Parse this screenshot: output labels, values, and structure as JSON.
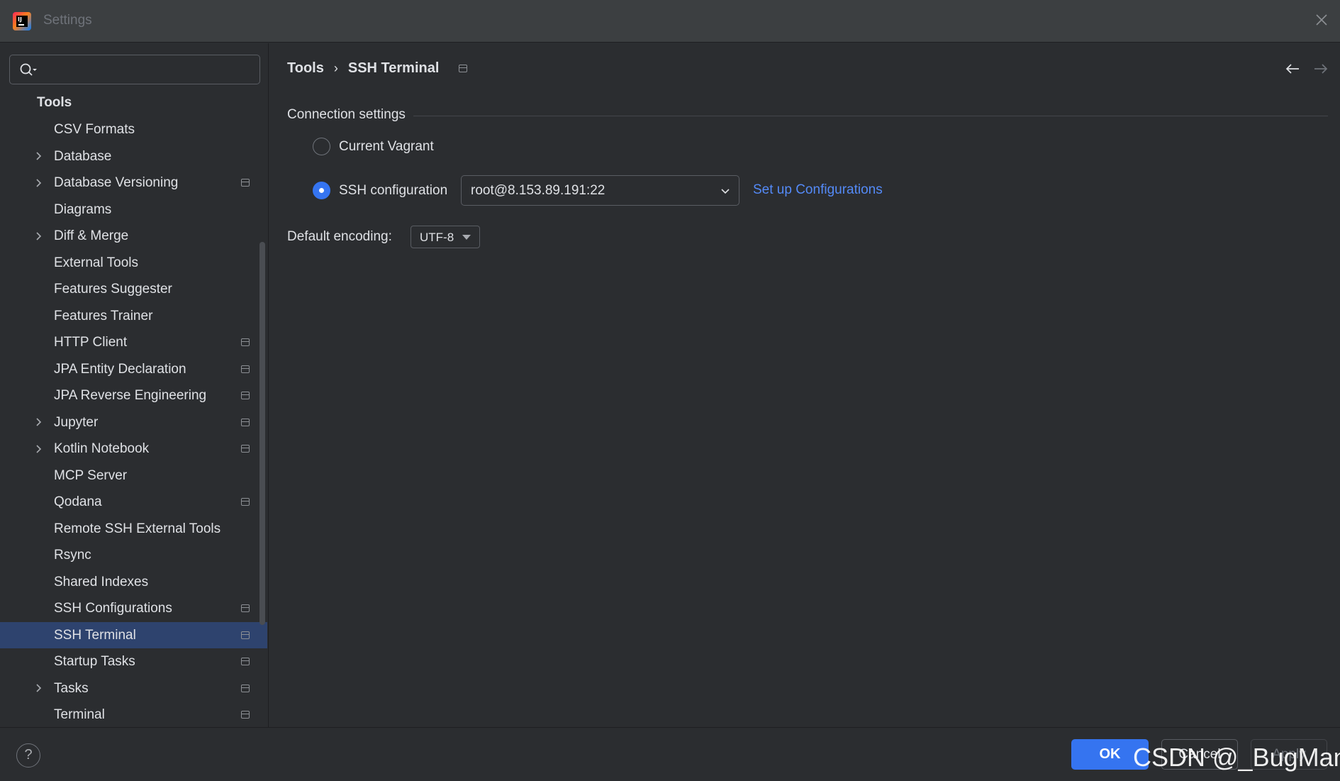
{
  "window": {
    "title": "Settings"
  },
  "search": {
    "placeholder": "",
    "value": ""
  },
  "sidebar": {
    "header": "Tools",
    "items": [
      {
        "label": "CSV Formats",
        "expandable": false,
        "project_icon": false,
        "selected": false
      },
      {
        "label": "Database",
        "expandable": true,
        "project_icon": false,
        "selected": false
      },
      {
        "label": "Database Versioning",
        "expandable": true,
        "project_icon": true,
        "selected": false
      },
      {
        "label": "Diagrams",
        "expandable": false,
        "project_icon": false,
        "selected": false
      },
      {
        "label": "Diff & Merge",
        "expandable": true,
        "project_icon": false,
        "selected": false
      },
      {
        "label": "External Tools",
        "expandable": false,
        "project_icon": false,
        "selected": false
      },
      {
        "label": "Features Suggester",
        "expandable": false,
        "project_icon": false,
        "selected": false
      },
      {
        "label": "Features Trainer",
        "expandable": false,
        "project_icon": false,
        "selected": false
      },
      {
        "label": "HTTP Client",
        "expandable": false,
        "project_icon": true,
        "selected": false
      },
      {
        "label": "JPA Entity Declaration",
        "expandable": false,
        "project_icon": true,
        "selected": false
      },
      {
        "label": "JPA Reverse Engineering",
        "expandable": false,
        "project_icon": true,
        "selected": false
      },
      {
        "label": "Jupyter",
        "expandable": true,
        "project_icon": true,
        "selected": false
      },
      {
        "label": "Kotlin Notebook",
        "expandable": true,
        "project_icon": true,
        "selected": false
      },
      {
        "label": "MCP Server",
        "expandable": false,
        "project_icon": false,
        "selected": false
      },
      {
        "label": "Qodana",
        "expandable": false,
        "project_icon": true,
        "selected": false
      },
      {
        "label": "Remote SSH External Tools",
        "expandable": false,
        "project_icon": false,
        "selected": false
      },
      {
        "label": "Rsync",
        "expandable": false,
        "project_icon": false,
        "selected": false
      },
      {
        "label": "Shared Indexes",
        "expandable": false,
        "project_icon": false,
        "selected": false
      },
      {
        "label": "SSH Configurations",
        "expandable": false,
        "project_icon": true,
        "selected": false
      },
      {
        "label": "SSH Terminal",
        "expandable": false,
        "project_icon": true,
        "selected": true
      },
      {
        "label": "Startup Tasks",
        "expandable": false,
        "project_icon": true,
        "selected": false
      },
      {
        "label": "Tasks",
        "expandable": true,
        "project_icon": true,
        "selected": false
      },
      {
        "label": "Terminal",
        "expandable": false,
        "project_icon": true,
        "selected": false
      }
    ]
  },
  "breadcrumb": {
    "parent": "Tools",
    "separator": "›",
    "current": "SSH Terminal"
  },
  "connection": {
    "section_title": "Connection settings",
    "options": [
      {
        "label": "Current Vagrant",
        "checked": false
      },
      {
        "label": "SSH configuration",
        "checked": true
      }
    ],
    "ssh_config_value": "root@8.153.89.191:22",
    "setup_link": "Set up Configurations"
  },
  "encoding": {
    "label": "Default encoding:",
    "value": "UTF-8"
  },
  "footer": {
    "help": "?",
    "ok": "OK",
    "cancel": "Cancel",
    "apply": "Apply",
    "watermark": "CSDN @_BugMan"
  },
  "colors": {
    "accent": "#3574f0",
    "link": "#548af7",
    "selection": "#2e436e",
    "background": "#2b2d30"
  }
}
